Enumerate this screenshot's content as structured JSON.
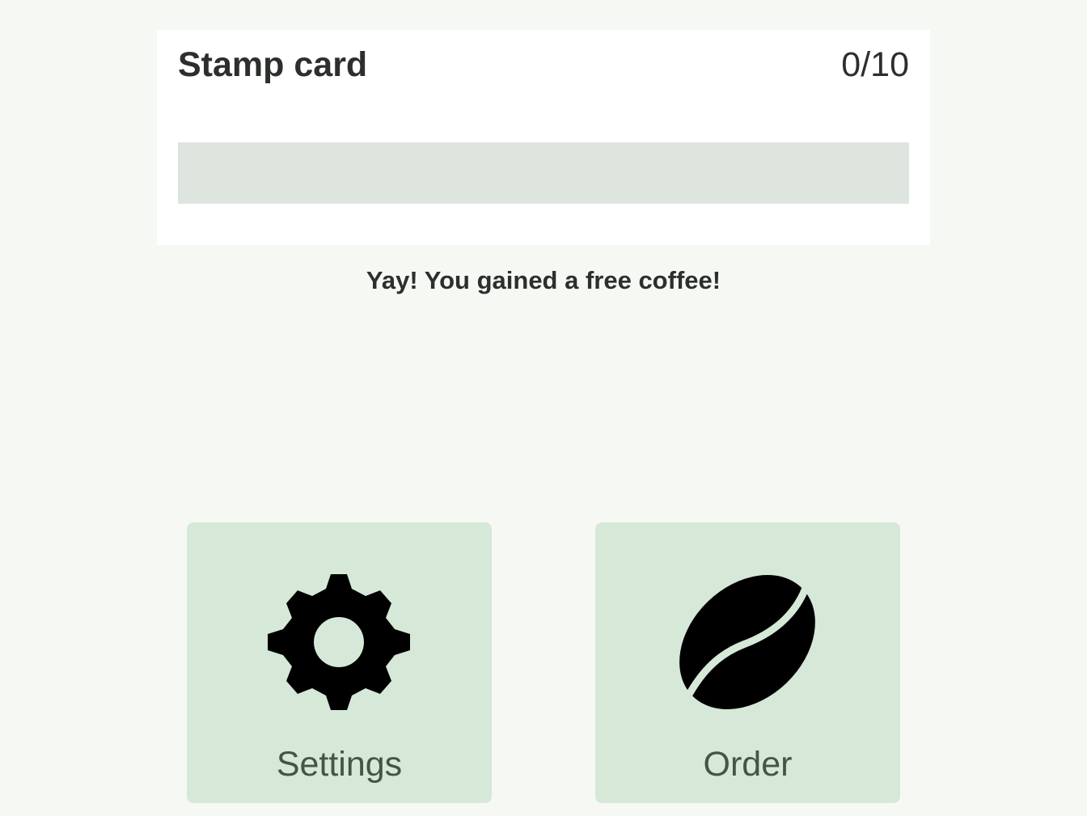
{
  "stamp_card": {
    "title": "Stamp card",
    "count": "0/10",
    "progress": 0.0
  },
  "message": "Yay! You gained a free coffee!",
  "actions": [
    {
      "label": "Settings",
      "icon": "gear-icon"
    },
    {
      "label": "Order",
      "icon": "coffee-bean-icon"
    }
  ],
  "colors": {
    "background": "#f6f9f3",
    "card": "#ffffff",
    "progress_track": "#dee5df",
    "tile": "#d6e8d7",
    "tile_label": "#435543",
    "text": "#2c2f2c"
  }
}
